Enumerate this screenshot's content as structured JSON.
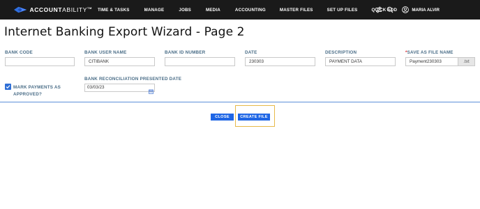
{
  "header": {
    "brand": "ACCOUNTABILITY",
    "brand_bold": "ACCOUNT",
    "brand_thin": "ABILITY",
    "brand_tm": "TM",
    "brand_color": "#2f6fe0",
    "nav_items": [
      "TIME & TASKS",
      "MANAGE",
      "JOBS",
      "MEDIA",
      "ACCOUNTING",
      "MASTER FILES",
      "SET UP FILES",
      "QUICK ADD"
    ],
    "icons": [
      "sliders-icon",
      "search-icon",
      "user-circle-icon"
    ],
    "user_name": "MARIA ALVIR"
  },
  "page": {
    "title": "Internet Banking Export Wizard - Page 2"
  },
  "form": {
    "bank_code": {
      "label": "BANK CODE",
      "value": ""
    },
    "bank_user_name": {
      "label": "BANK USER NAME",
      "value": "CITIBANK"
    },
    "bank_id_number": {
      "label": "BANK ID NUMBER",
      "value": ""
    },
    "date": {
      "label": "DATE",
      "value": "230303"
    },
    "description": {
      "label": "DESCRIPTION",
      "value": "PAYMENT DATA"
    },
    "save_as_file_name": {
      "required_mark": "*",
      "label": "SAVE AS FILE NAME",
      "value": "Payment230303",
      "suffix": ".txt"
    },
    "mark_payments": {
      "label": "MARK PAYMENTS AS APPROVED?",
      "checked": true
    },
    "bank_reconciliation": {
      "label": "BANK RECONCILIATION PRESENTED DATE",
      "value": "03/03/23"
    }
  },
  "actions": {
    "close_label": "CLOSE",
    "create_file_label": "CREATE FILE",
    "button_color": "#1f66e5",
    "highlight_color": "#e6b94a"
  }
}
